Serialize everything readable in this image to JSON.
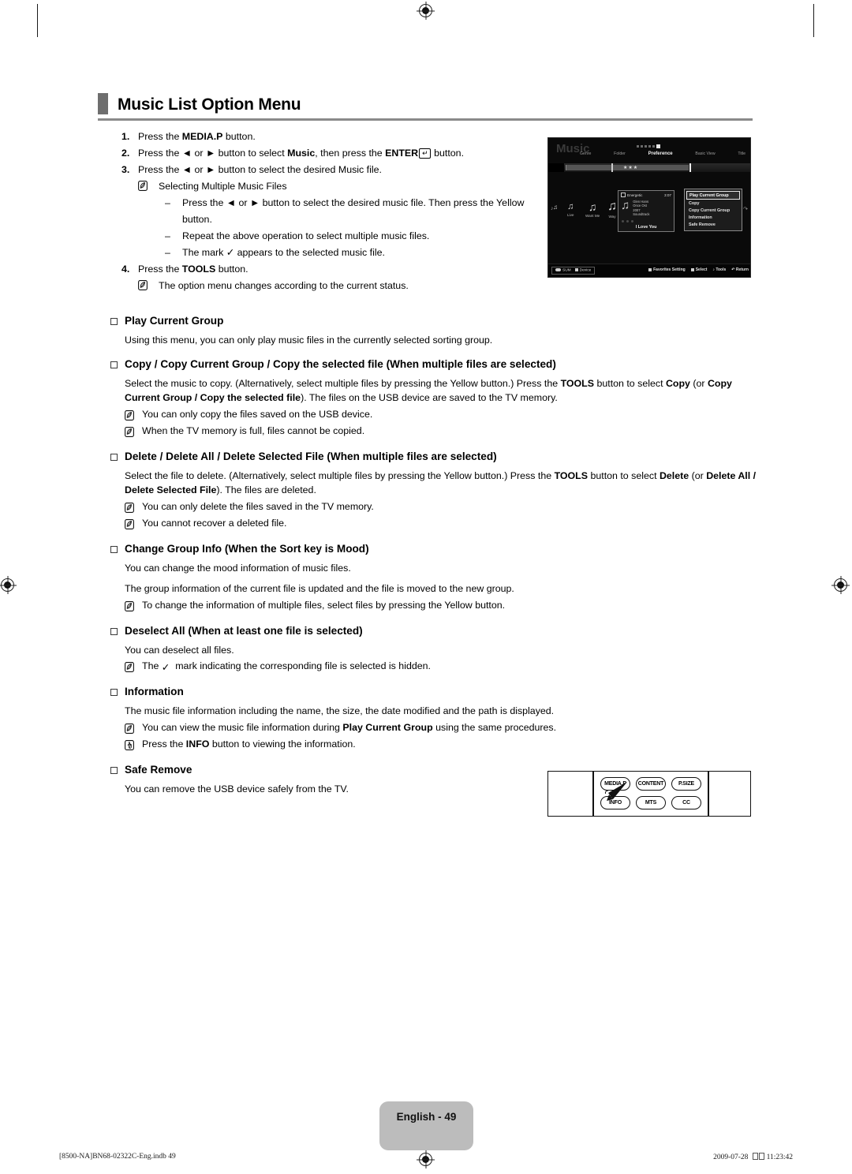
{
  "section": {
    "title": "Music List Option Menu"
  },
  "steps": [
    {
      "num": "1.",
      "html": "Press the <b>MEDIA.P</b> button."
    },
    {
      "num": "2.",
      "html": "Press the ◄ or ► button to select <b>Music</b>, then press the <b>ENTER</b><span class=\"enterkey\">↵</span> button."
    },
    {
      "num": "3.",
      "html": "Press the ◄ or ► button to select the desired Music file."
    }
  ],
  "substep_note": "Selecting Multiple Music Files",
  "dashes": [
    "Press the ◄ or ► button to select the desired music file. Then press the Yellow button.",
    "Repeat the above operation to select multiple music files.",
    "The mark ✓ appears to the selected music file."
  ],
  "step4": {
    "num": "4.",
    "html": "Press the <b>TOOLS</b> button."
  },
  "step4_note": "The option menu changes according to the current status.",
  "tv": {
    "screen_title": "Music",
    "nav": [
      "Genre",
      "Folder",
      "Preference",
      "Basic View",
      "Title"
    ],
    "nav_active": "Preference",
    "rating_stars": "★★★",
    "thumbnails": [
      {
        "label": "Live"
      },
      {
        "label": "Want Me"
      },
      {
        "label": "Way"
      }
    ],
    "detail": {
      "mood": "Energetic",
      "duration": "3:07",
      "artist": "Glen Hans",
      "album": "Once Ost",
      "year": "2007",
      "genre": "Soundtrack",
      "track_title": "I Love You"
    },
    "menu": {
      "items": [
        "Play Current Group",
        "Copy",
        "Copy Current Group",
        "Information",
        "Safe Remove"
      ],
      "selected": "Play Current Group"
    },
    "footer": {
      "left": [
        "SUM",
        "Device"
      ],
      "right": [
        "Favorites Setting",
        "Select",
        "Tools",
        "Return"
      ]
    }
  },
  "sections": [
    {
      "id": "play-current-group",
      "heading": "Play Current Group",
      "paragraphs": [
        "Using this menu, you can only play music files in the currently selected sorting group."
      ],
      "notes": []
    },
    {
      "id": "copy",
      "heading": "Copy / Copy Current Group / Copy the selected file (When multiple files are selected)",
      "paragraphs_html": [
        "Select the music to copy. (Alternatively, select multiple files by pressing the Yellow button.) Press the <b>TOOLS</b> button to select <b>Copy</b> (or <b>Copy Current Group / Copy the selected file</b>). The files on the USB device are saved to the TV memory."
      ],
      "notes": [
        "You can only copy the files saved on the USB device.",
        "When the TV memory is full, files cannot be copied."
      ]
    },
    {
      "id": "delete",
      "heading": "Delete / Delete All / Delete Selected File (When multiple files are selected)",
      "paragraphs_html": [
        "Select the file to delete. (Alternatively, select multiple files by pressing the Yellow button.) Press the <b>TOOLS</b> button to select <b>Delete</b> (or <b>Delete All / Delete Selected File</b>). The files are deleted."
      ],
      "notes": [
        "You can only delete the files saved in the TV memory.",
        "You cannot recover a deleted file."
      ]
    },
    {
      "id": "change-group-info",
      "heading": "Change Group Info (When the Sort key is Mood)",
      "paragraphs_html": [
        "You can change the mood information of music files.",
        "The group information of the current file is updated and the file is moved to the new group."
      ],
      "notes": [
        "To change the information of multiple files, select files by pressing the Yellow button."
      ]
    },
    {
      "id": "deselect-all",
      "heading": "Deselect All (When at least one file is selected)",
      "paragraphs_html": [
        "You can deselect all files."
      ],
      "notes_html": [
        "The <span class=\"checkmark\">✓</span> mark indicating the corresponding file is selected is hidden."
      ]
    },
    {
      "id": "information",
      "heading": "Information",
      "paragraphs_html": [
        "The music file information including the name, the size, the date modified and the path is displayed."
      ],
      "notes_html": [
        "You can view the music file information during <b>Play Current Group</b> using the same procedures."
      ],
      "hand_notes_html": [
        "Press the <b>INFO</b> button to viewing the information."
      ]
    },
    {
      "id": "safe-remove",
      "heading": "Safe Remove",
      "paragraphs_html": [
        "You can remove the USB device safely from the TV."
      ],
      "notes": []
    }
  ],
  "remote": {
    "row1": [
      "MEDIA.P",
      "CONTENT",
      "P.SIZE"
    ],
    "row2": [
      "INFO",
      "MTS",
      "CC"
    ]
  },
  "page_footer": {
    "page_label": "English - 49",
    "file_name": "[8500-NA]BN68-02322C-Eng.indb   49",
    "date": "2009-07-28",
    "time": "11:23:42"
  }
}
